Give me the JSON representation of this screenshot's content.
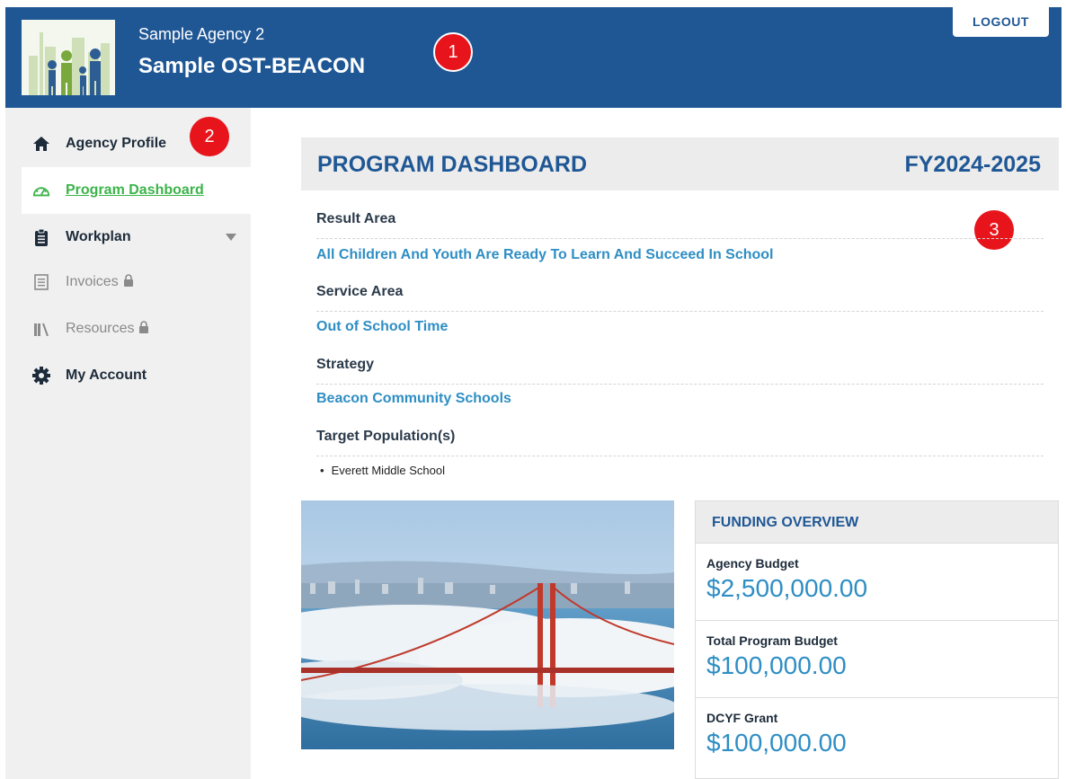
{
  "header": {
    "agency_name": "Sample Agency 2",
    "program_name": "Sample OST-BEACON",
    "logout_label": "LOGOUT",
    "brand_color": "#1f5795"
  },
  "markers": [
    "1",
    "2",
    "3"
  ],
  "sidebar": {
    "items": [
      {
        "label": "Agency Profile",
        "icon": "home-icon",
        "state": "normal"
      },
      {
        "label": "Program Dashboard",
        "icon": "dashboard-gauge-icon",
        "state": "active"
      },
      {
        "label": "Workplan",
        "icon": "clipboard-icon",
        "state": "normal",
        "has_submenu": true
      },
      {
        "label": "Invoices",
        "icon": "document-icon",
        "state": "locked"
      },
      {
        "label": "Resources",
        "icon": "books-icon",
        "state": "locked"
      },
      {
        "label": "My Account",
        "icon": "gear-icon",
        "state": "normal"
      }
    ]
  },
  "dashboard": {
    "title": "PROGRAM DASHBOARD",
    "fiscal_year": "FY2024-2025",
    "result_area_label": "Result Area",
    "result_area_value": "All Children And Youth Are Ready To Learn And Succeed In School",
    "service_area_label": "Service Area",
    "service_area_value": "Out of School Time",
    "strategy_label": "Strategy",
    "strategy_value": "Beacon Community Schools",
    "target_population_label": "Target Population(s)",
    "target_populations": [
      "Everett Middle School"
    ]
  },
  "funding": {
    "title": "FUNDING OVERVIEW",
    "rows": [
      {
        "label": "Agency Budget",
        "value": "$2,500,000.00"
      },
      {
        "label": "Total Program Budget",
        "value": "$100,000.00"
      },
      {
        "label": "DCYF Grant",
        "value": "$100,000.00"
      }
    ]
  },
  "colors": {
    "link": "#2e8ec4",
    "active_nav": "#3cb44a",
    "marker": "#e8141b"
  }
}
